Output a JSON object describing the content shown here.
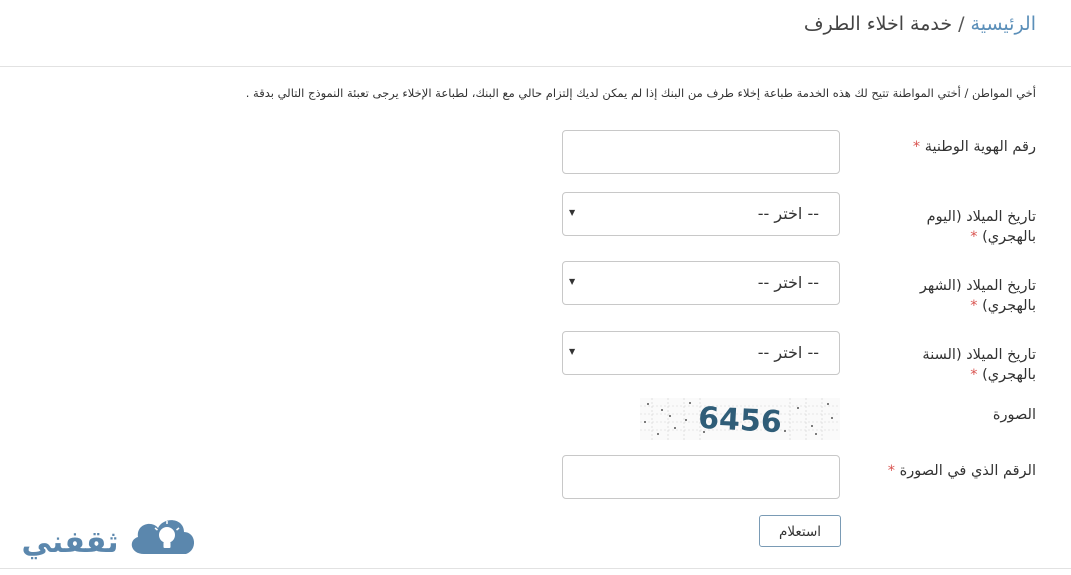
{
  "breadcrumb": {
    "home": "الرئيسية",
    "separator": "/",
    "current": "خدمة اخلاء الطرف"
  },
  "intro_text": "أخي المواطن / أختي المواطنة تتيح لك هذه الخدمة طباعة إخلاء طرف من البنك إذا لم يمكن لديك إلتزام حالي مع البنك، لطباعة الإخلاء يرجى تعبئة النموذج التالي بدقة .",
  "form": {
    "required_mark": "*",
    "national_id": {
      "label": "رقم الهوية الوطنية",
      "value": ""
    },
    "birth_day": {
      "label_line1": "تاريخ الميلاد (اليوم",
      "label_line2": "بالهجري)",
      "selected": "-- اختر --"
    },
    "birth_month": {
      "label_line1": "تاريخ الميلاد (الشهر",
      "label_line2": "بالهجري)",
      "selected": "-- اختر --"
    },
    "birth_year": {
      "label_line1": "تاريخ الميلاد (السنة",
      "label_line2": "بالهجري)",
      "selected": "-- اختر --"
    },
    "captcha": {
      "label": "الصورة",
      "code": "6456"
    },
    "captcha_input": {
      "label": "الرقم الذي في الصورة",
      "value": ""
    },
    "submit_label": "استعلام"
  },
  "logo": {
    "text": "ثقفني"
  },
  "colors": {
    "link": "#5b8fb9",
    "required": "#d9534f",
    "captcha_text": "#2f5d78",
    "logo": "#5b87ad"
  }
}
